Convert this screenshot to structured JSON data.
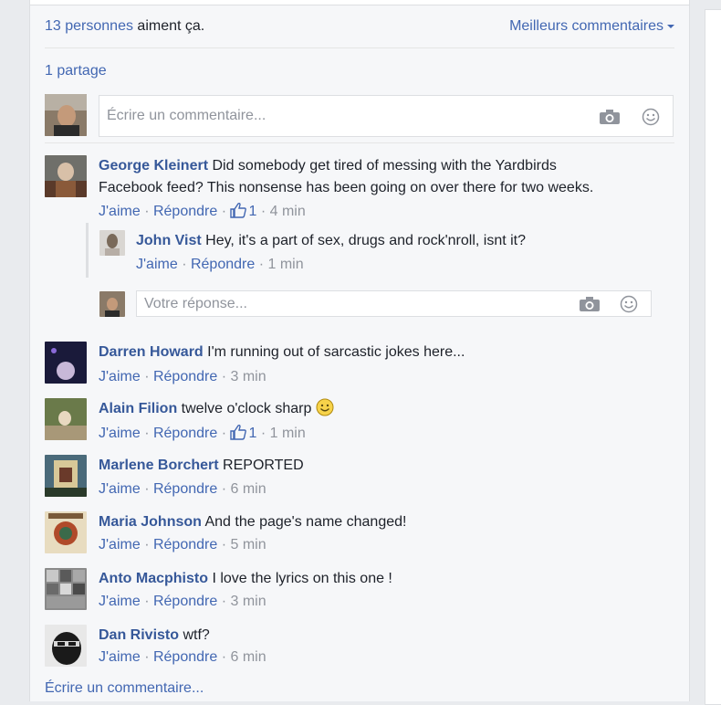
{
  "summary": {
    "likes_count": "13 personnes",
    "likes_suffix": " aiment ça.",
    "sort_label": "Meilleurs commentaires",
    "shares": "1 partage"
  },
  "composer": {
    "placeholder": "Écrire un commentaire...",
    "camera_icon": "camera-icon",
    "emoji_icon": "smiley-icon"
  },
  "comments": [
    {
      "author": "George Kleinert",
      "text": " Did somebody get tired of messing with the Yardbirds",
      "text2": "Facebook feed? This nonsense has been going on over there for two weeks.",
      "like": "J'aime",
      "reply": "Répondre",
      "likes": "1",
      "time": "4 min",
      "replies": [
        {
          "author": "John Vist",
          "text": " Hey, it's a part of sex, drugs and rock'nroll, isnt it?",
          "like": "J'aime",
          "reply": "Répondre",
          "time": "1 min"
        }
      ],
      "reply_placeholder": "Votre réponse..."
    },
    {
      "author": "Darren Howard",
      "text": " I'm running out of sarcastic jokes here...",
      "like": "J'aime",
      "reply": "Répondre",
      "time": "3 min"
    },
    {
      "author": "Alain Filion",
      "text": " twelve o'clock sharp",
      "like": "J'aime",
      "reply": "Répondre",
      "likes": "1",
      "time": "1 min"
    },
    {
      "author": "Marlene Borchert",
      "text": " REPORTED",
      "like": "J'aime",
      "reply": "Répondre",
      "time": "6 min"
    },
    {
      "author": "Maria Johnson",
      "text": " And the page's name changed!",
      "like": "J'aime",
      "reply": "Répondre",
      "time": "5 min"
    },
    {
      "author": "Anto Macphisto",
      "text": " I love the lyrics on this one !",
      "like": "J'aime",
      "reply": "Répondre",
      "time": "3 min"
    },
    {
      "author": "Dan Rivisto",
      "text": " wtf?",
      "like": "J'aime",
      "reply": "Répondre",
      "time": "6 min"
    }
  ],
  "footer": {
    "write_comment": "Écrire un commentaire..."
  },
  "separator": "·"
}
